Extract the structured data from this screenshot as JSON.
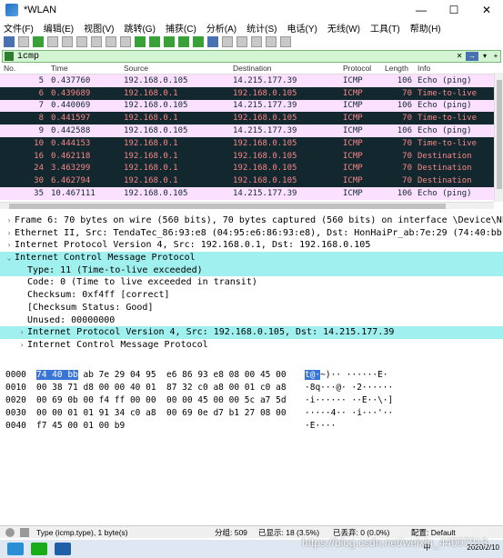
{
  "window": {
    "title": "*WLAN",
    "minimize": "—",
    "maximize": "☐",
    "close": "✕"
  },
  "menu": [
    "文件(F)",
    "编辑(E)",
    "视图(V)",
    "跳转(G)",
    "捕获(C)",
    "分析(A)",
    "统计(S)",
    "电话(Y)",
    "无线(W)",
    "工具(T)",
    "帮助(H)"
  ],
  "filter": {
    "value": "icmp",
    "arrow_button": "→",
    "dropdown_button": "▾",
    "add_button": "+"
  },
  "colors": {
    "echo_row_bg": "#fce0ff",
    "ttl_row_bg": "#12272e",
    "ttl_row_fg": "#f78787",
    "selected_row_bg": "#0078d7",
    "highlight_line_bg": "#a0f0f0",
    "byte_select_bg": "#3875d7"
  },
  "packet_list": {
    "headers": {
      "no": "No.",
      "time": "Time",
      "src": "Source",
      "dst": "Destination",
      "proto": "Protocol",
      "len": "Length",
      "info": "Info"
    },
    "rows": [
      {
        "no": "5",
        "time": "0.437760",
        "src": "192.168.0.105",
        "dst": "14.215.177.39",
        "proto": "ICMP",
        "len": "106",
        "info": "Echo (ping)",
        "style": "echo"
      },
      {
        "no": "6",
        "time": "0.439689",
        "src": "192.168.0.1",
        "dst": "192.168.0.105",
        "proto": "ICMP",
        "len": "70",
        "info": "Time-to-live",
        "style": "ttl"
      },
      {
        "no": "7",
        "time": "0.440069",
        "src": "192.168.0.105",
        "dst": "14.215.177.39",
        "proto": "ICMP",
        "len": "106",
        "info": "Echo (ping)",
        "style": "echo"
      },
      {
        "no": "8",
        "time": "0.441597",
        "src": "192.168.0.1",
        "dst": "192.168.0.105",
        "proto": "ICMP",
        "len": "70",
        "info": "Time-to-live",
        "style": "ttl"
      },
      {
        "no": "9",
        "time": "0.442588",
        "src": "192.168.0.105",
        "dst": "14.215.177.39",
        "proto": "ICMP",
        "len": "106",
        "info": "Echo (ping)",
        "style": "echo"
      },
      {
        "no": "10",
        "time": "0.444153",
        "src": "192.168.0.1",
        "dst": "192.168.0.105",
        "proto": "ICMP",
        "len": "70",
        "info": "Time-to-live",
        "style": "ttl"
      },
      {
        "no": "16",
        "time": "0.462118",
        "src": "192.168.0.1",
        "dst": "192.168.0.105",
        "proto": "ICMP",
        "len": "70",
        "info": "Destination",
        "style": "ttl"
      },
      {
        "no": "24",
        "time": "3.463299",
        "src": "192.168.0.1",
        "dst": "192.168.0.105",
        "proto": "ICMP",
        "len": "70",
        "info": "Destination",
        "style": "ttl"
      },
      {
        "no": "30",
        "time": "6.462794",
        "src": "192.168.0.1",
        "dst": "192.168.0.105",
        "proto": "ICMP",
        "len": "70",
        "info": "Destination",
        "style": "ttl"
      },
      {
        "no": "35",
        "time": "10.467111",
        "src": "192.168.0.105",
        "dst": "14.215.177.39",
        "proto": "ICMP",
        "len": "106",
        "info": "Echo (ping)",
        "style": "echo"
      }
    ]
  },
  "detail": [
    {
      "indent": 0,
      "arrow": "›",
      "text": "Frame 6: 70 bytes on wire (560 bits), 70 bytes captured (560 bits) on interface \\Device\\NPF_{",
      "hl": false
    },
    {
      "indent": 0,
      "arrow": "›",
      "text": "Ethernet II, Src: TendaTec_86:93:e8 (04:95:e6:86:93:e8), Dst: HonHaiPr_ab:7e:29 (74:40:bb:ab:",
      "hl": false
    },
    {
      "indent": 0,
      "arrow": "›",
      "text": "Internet Protocol Version 4, Src: 192.168.0.1, Dst: 192.168.0.105",
      "hl": false
    },
    {
      "indent": 0,
      "arrow": "⌄",
      "text": "Internet Control Message Protocol",
      "hl": true
    },
    {
      "indent": 1,
      "arrow": "",
      "text": "Type: 11 (Time-to-live exceeded)",
      "hl": true
    },
    {
      "indent": 1,
      "arrow": "",
      "text": "Code: 0 (Time to live exceeded in transit)",
      "hl": false
    },
    {
      "indent": 1,
      "arrow": "",
      "text": "Checksum: 0xf4ff [correct]",
      "hl": false
    },
    {
      "indent": 1,
      "arrow": "",
      "text": "[Checksum Status: Good]",
      "hl": false
    },
    {
      "indent": 1,
      "arrow": "",
      "text": "Unused: 00000000",
      "hl": false
    },
    {
      "indent": 1,
      "arrow": "›",
      "text": "Internet Protocol Version 4, Src: 192.168.0.105, Dst: 14.215.177.39",
      "hl": true
    },
    {
      "indent": 1,
      "arrow": "›",
      "text": "Internet Control Message Protocol",
      "hl": false
    }
  ],
  "bytes": [
    {
      "off": "0000",
      "sel": "74 40 bb",
      "hex": " ab 7e 29 04 95  e6 86 93 e8 08 00 45 00",
      "asel": "t@·",
      "ascii": "~)·· ······E·"
    },
    {
      "off": "0010",
      "sel": "",
      "hex": "00 38 71 d8 00 00 40 01  87 32 c0 a8 00 01 c0 a8",
      "asel": "",
      "ascii": "·8q···@· ·2······"
    },
    {
      "off": "0020",
      "sel": "",
      "hex": "00 69 0b 00 f4 ff 00 00  00 00 45 00 00 5c a7 5d",
      "asel": "",
      "ascii": "·i······ ··E··\\·]"
    },
    {
      "off": "0030",
      "sel": "",
      "hex": "00 00 01 01 91 34 c0 a8  00 69 0e d7 b1 27 08 00",
      "asel": "",
      "ascii": "·····4·· ·i···'··"
    },
    {
      "off": "0040",
      "sel": "",
      "hex": "f7 45 00 01 00 b9",
      "asel": "",
      "ascii": "·E····"
    }
  ],
  "status": {
    "field": "Type (icmp.type), 1 byte(s)",
    "packets": "分组: 509",
    "displayed": "已显示: 18 (3.5%)",
    "dropped": "已丢弃: 0 (0.0%)",
    "profile": "配置: Default"
  },
  "taskbar": {
    "ime": "中",
    "date": "2020/2/10"
  },
  "watermark": "https://blog.csdn.net/weixin_44007213"
}
